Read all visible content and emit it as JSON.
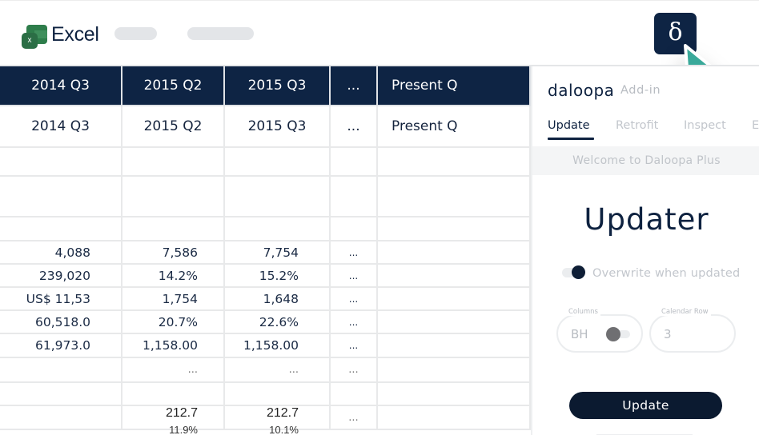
{
  "topbar": {
    "app_title": "Excel",
    "excel_icon_letter": "x",
    "addin_button_glyph": "δ"
  },
  "sheet": {
    "header_row": [
      "2014 Q3",
      "2015 Q2",
      "2015 Q3",
      "...",
      "Present Q"
    ],
    "label_row": [
      "2014 Q3",
      "2015 Q2",
      "2015 Q3",
      "...",
      "Present Q"
    ],
    "data_rows": [
      [
        "",
        "",
        "",
        "",
        ""
      ],
      [
        "",
        "",
        "",
        "",
        ""
      ],
      [
        "",
        "",
        "",
        "",
        ""
      ],
      [
        "4,088",
        "7,586",
        "7,754",
        "...",
        ""
      ],
      [
        "239,020",
        "14.2%",
        "15.2%",
        "...",
        ""
      ],
      [
        "US$ 11,53",
        "1,754",
        "1,648",
        "...",
        ""
      ],
      [
        "60,518.0",
        "20.7%",
        "22.6%",
        "...",
        ""
      ],
      [
        "61,973.0",
        "1,158.00",
        "1,158.00",
        "...",
        ""
      ],
      [
        "",
        "...",
        "...",
        "...",
        ""
      ],
      [
        "",
        "",
        "",
        "",
        ""
      ],
      [
        "",
        "212.7",
        "212.7",
        "...",
        ""
      ]
    ],
    "overflow_row_partial": [
      "",
      "11.9%",
      "10.1%",
      "",
      ""
    ]
  },
  "panel": {
    "brand": "daloopa",
    "brand_sub": "Add-in",
    "tabs": [
      {
        "label": "Update",
        "active": true
      },
      {
        "label": "Retrofit",
        "active": false
      },
      {
        "label": "Inspect",
        "active": false
      },
      {
        "label": "E",
        "active": false
      }
    ],
    "welcome": "Welcome to Daloopa Plus",
    "title": "Updater",
    "overwrite_toggle": {
      "label": "Overwrite when updated",
      "on": true
    },
    "columns_field": {
      "label": "Columns",
      "value": "BH"
    },
    "calendar_row_field": {
      "label": "Calendar Row",
      "value": "3"
    },
    "update_button": "Update"
  },
  "colors": {
    "brand_navy": "#0e2444",
    "cursor_teal": "#3aa99a",
    "excel_green": "#2e7d4b"
  }
}
